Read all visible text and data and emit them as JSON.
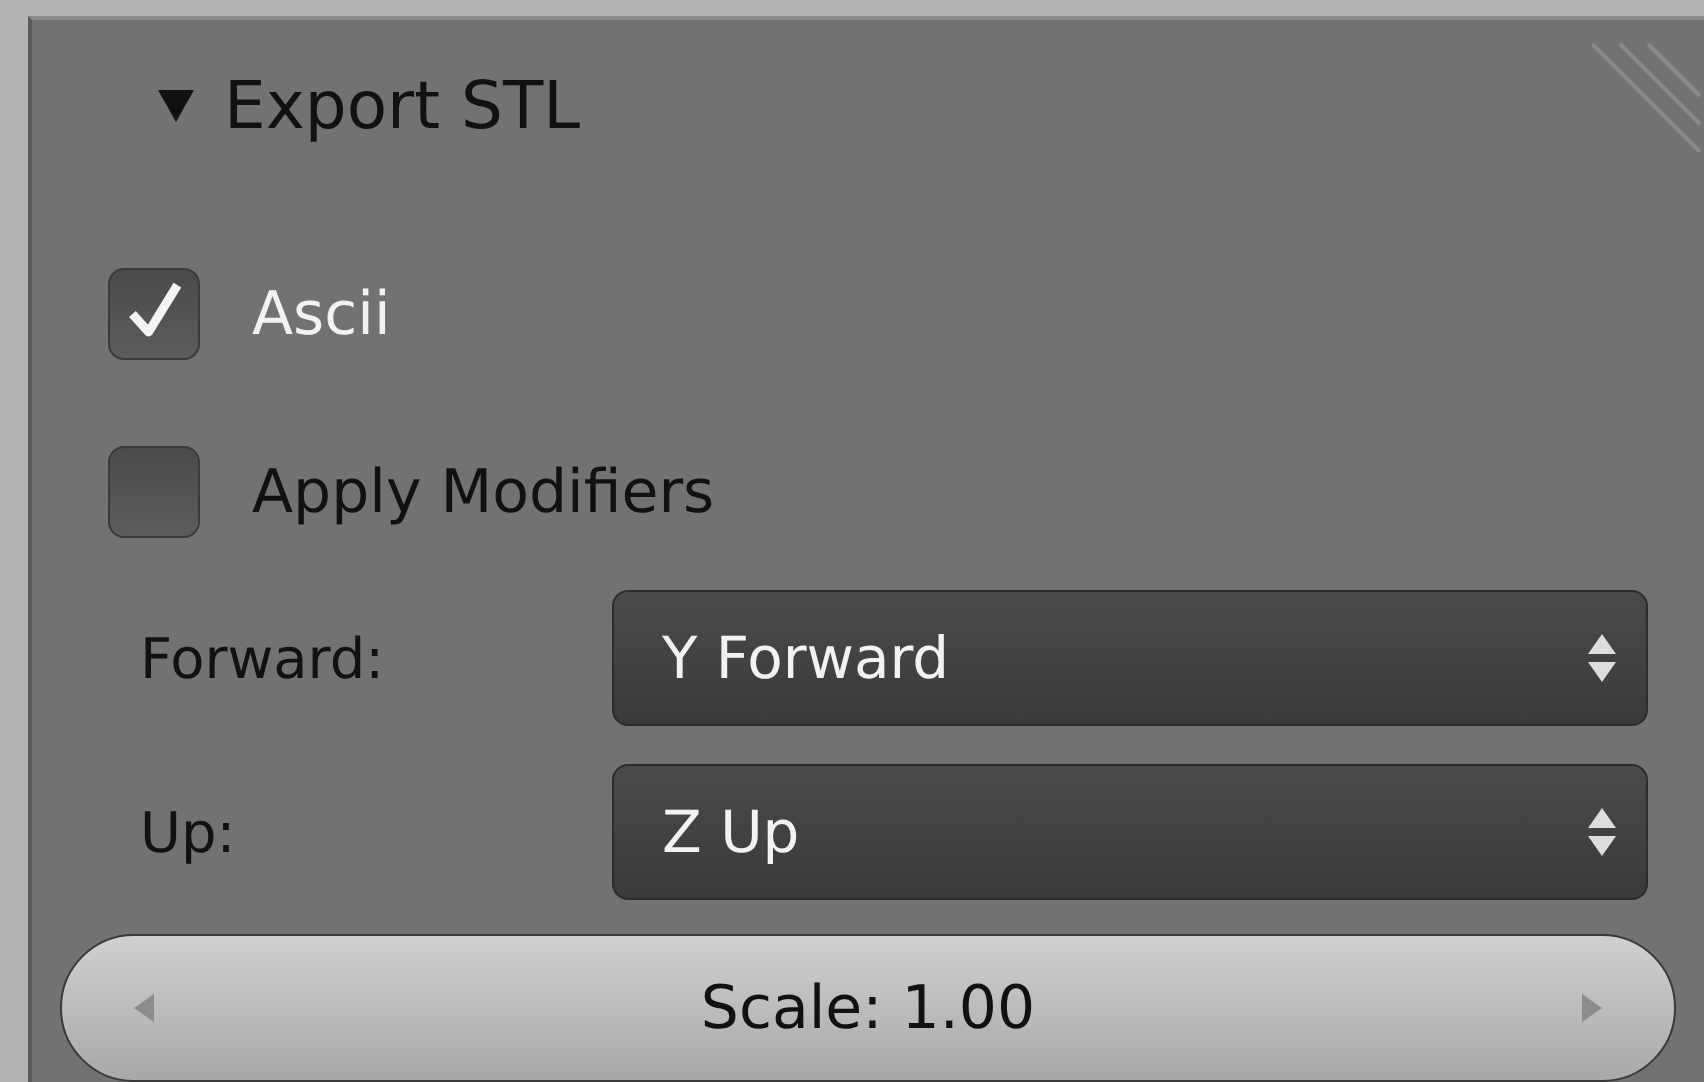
{
  "panel": {
    "title": "Export STL",
    "expanded": true
  },
  "options": [
    {
      "label": "Ascii",
      "checked": true
    },
    {
      "label": "Apply Modifiers",
      "checked": false
    }
  ],
  "selects": [
    {
      "label": "Forward:",
      "value": "Y Forward"
    },
    {
      "label": "Up:",
      "value": "Z Up"
    }
  ],
  "scale": {
    "text": "Scale: 1.00"
  }
}
